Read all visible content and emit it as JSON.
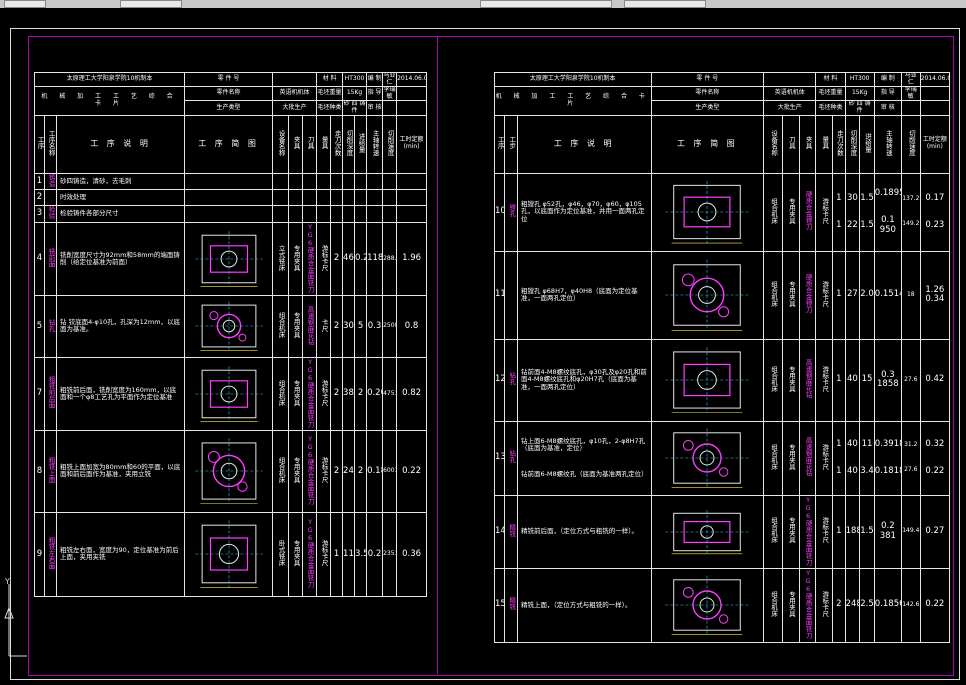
{
  "header": {
    "school": "太原理工大学阳泉学院10机制本",
    "part_no_label": "零 件 号",
    "material_label": "材  料",
    "material_value": "HT300",
    "author_label": "编  制",
    "author_value": "马亚仁",
    "date_value": "2014.06.01",
    "title": "机 械 加 工 工 艺 综 合 卡 片",
    "part_name_label": "零件名称",
    "part_name_value": "英语机机体",
    "blank_weight_label": "毛坯重量",
    "blank_weight_value": "15Kg",
    "designer_label": "指  导",
    "designer_value": "李瑞敏",
    "production_type_label": "生产类型",
    "production_type_value": "大批生产",
    "blank_type_label": "毛坯种类",
    "blank_type_value": "砂 四 铸 件",
    "reviewer_label": "审  核"
  },
  "columns": {
    "proc_no": "工序",
    "proc_name": "工序名称",
    "step": "工步",
    "desc": "工 序 说 明",
    "sketch": "工  序  简  图",
    "equipment": "设备名称",
    "fixture": "夹具",
    "tool": "刀具",
    "gauge": "量具",
    "passes": "走刀次数",
    "depth": "切削深度",
    "feed": "进给量",
    "speed": "主轴转速",
    "cut_speed": "切削速度",
    "time": "工时定额(min)"
  },
  "left_rows": [
    {
      "no": "1",
      "name": "铸造",
      "desc": "砂四铸造，清砂，去毛刺",
      "equip": "",
      "fix": "",
      "tool": "",
      "gauge": "",
      "passes": "",
      "depth": "",
      "feed": "",
      "speed": "",
      "vc": "",
      "time": ""
    },
    {
      "no": "2",
      "name": "",
      "desc": "时效处理",
      "equip": "",
      "fix": "",
      "tool": "",
      "gauge": "",
      "passes": "",
      "depth": "",
      "feed": "",
      "speed": "",
      "vc": "",
      "time": ""
    },
    {
      "no": "3",
      "name": "检验",
      "desc": "检验铸件各部分尺寸",
      "equip": "",
      "fix": "",
      "tool": "",
      "gauge": "",
      "passes": "",
      "depth": "",
      "feed": "",
      "speed": "",
      "vc": "",
      "time": ""
    },
    {
      "no": "4",
      "name": "铣前面",
      "desc": "铣削宽度尺寸为92mm和58mm的端面铸削（给定位基准为前面）",
      "equip": "立式铣床",
      "fix": "专用夹具",
      "tool": "YG6硬质合金面铣刀",
      "gauge": "游标卡尺",
      "passes": "2",
      "depth": "4624.0",
      "feed": "0.2",
      "speed": "1180",
      "vc": "288.4",
      "time": "1.96"
    },
    {
      "no": "5",
      "name": "钻孔",
      "desc": "钻 铰底面4-φ10孔，孔深为12mm，以底面为基准。",
      "equip": "组合机床",
      "fix": "专用夹具",
      "tool": "高速钢麻花钻",
      "gauge": "卡尺",
      "passes": "2",
      "depth": "30",
      "feed": "5",
      "speed": "0.3",
      "vc": "250078.5",
      "time": "0.8"
    },
    {
      "no": "7",
      "name": "粗铣前后面",
      "desc": "粗铣前后面，铣削宽度为160mm，以底面和一个φ8工艺孔为平面作为定位基准",
      "equip": "组合机床",
      "fix": "专用夹具",
      "tool": "YG6硬质合金面铣刀",
      "gauge": "游标卡尺",
      "passes": "2",
      "depth": "380",
      "feed": "2",
      "speed": "0.20",
      "vc": "475166.4",
      "time": "0.82"
    },
    {
      "no": "8",
      "name": "粗铣上面",
      "desc": "粗铣上面加宽为80mm和60的平面，以底面和前后面作为基准，夹用立铣",
      "equip": "组合机床",
      "fix": "专用夹具",
      "tool": "YG6硬质合金面铣刀",
      "gauge": "游标卡尺",
      "passes": "2",
      "depth": "244",
      "feed": "2",
      "speed": "0.18",
      "vc": "600150.72",
      "time": "0.22"
    },
    {
      "no": "9",
      "name": "粗铣左右面",
      "desc": "粗铣左右面，宽度为90，定位基准为前后上面，夹用夹铣",
      "equip": "卧式铣床",
      "fix": "专用夹具",
      "tool": "YG6硬质合金面铣刀",
      "gauge": "游标卡尺",
      "passes": "1",
      "depth": "115",
      "feed": "3.5",
      "speed": "0.2",
      "vc": "235116.1",
      "time": "0.36"
    }
  ],
  "left_extra": {
    "equip_code_4": "X52K",
    "equip_code_9": "X6025"
  },
  "right_rows": [
    {
      "no": "10",
      "name": "镗孔",
      "desc": "粗镗孔 φ52孔，φ46，φ70，φ60，φ105孔，以底面作为定位基准，并用一面两孔定位",
      "equip": "组合机床",
      "fix": "专用夹具",
      "tool": "硬质合金镗刀",
      "gauge": "游标卡尺",
      "p1": "1",
      "d1": "30",
      "f1": "1.5",
      "s1": "0.18950",
      "v1": "137.2",
      "t1": "0.17",
      "p2": "1",
      "d2": "22",
      "f2": "1.5",
      "s2": "0.1 950",
      "v2": "149.2",
      "t2": "0.23"
    },
    {
      "no": "11",
      "name": "",
      "desc": "粗镗孔 φ68H7，φ40H8（底面为定位基准，一面两孔定位）",
      "equip": "组合机床",
      "fix": "专用夹具",
      "tool": "硬质合金镗刀",
      "gauge": "游标卡尺",
      "p1": "1",
      "d1": "27",
      "f1": "2.0",
      "s1": "0.15144",
      "v1": "18",
      "t1": "1.26 0.34",
      "p2": "",
      "d2": "",
      "f2": "",
      "s2": "",
      "v2": "",
      "t2": ""
    },
    {
      "no": "12",
      "name": "钻孔",
      "desc": "钻前面4-M8螺纹底孔，φ30孔及φ20孔和前面4-M8螺纹底孔和φ20H7孔（底面为基准，一面两孔定位）",
      "equip": "组合机床",
      "fix": "专用夹具",
      "tool": "高速钢麻花钻",
      "gauge": "游标卡尺",
      "p1": "1",
      "d1": "40",
      "f1": "15",
      "s1": "0.3 1858",
      "v1": "27.6",
      "t1": "0.42",
      "p2": "",
      "d2": "",
      "f2": "",
      "s2": "",
      "v2": "",
      "t2": ""
    },
    {
      "no": "13",
      "name": "钻孔",
      "desc": "钻上面6-M8螺纹底孔，φ10孔，2-φ8H7孔（底面为基准，定位）",
      "desc2": "钻前面6-M8螺纹孔（底面为基准两孔定位）",
      "equip": "组合机床",
      "fix": "专用夹具",
      "tool": "高速钢麻花钻",
      "gauge": "游标卡尺",
      "p1": "1",
      "d1": "40",
      "f1": "11",
      "s1": "0.391858",
      "v1": "31.2",
      "t1": "0.32",
      "p2": "1",
      "d2": "40",
      "f2": "3.4",
      "s2": "0.181858",
      "v2": "27.6",
      "t2": "0.22"
    },
    {
      "no": "14",
      "name": "精铣",
      "desc": "精铣前后面，（定位方式与粗铣的一样）。",
      "equip": "组合机床",
      "fix": "专用夹具",
      "tool": "YG6硬质合金面铣刀",
      "gauge": "游标卡尺",
      "p1": "1",
      "d1": "188",
      "f1": "1.5",
      "s1": "0.2 381",
      "v1": "149.4",
      "t1": "0.27",
      "p2": "",
      "d2": "",
      "f2": "",
      "s2": "",
      "v2": "",
      "t2": ""
    },
    {
      "no": "15",
      "name": "精铣",
      "desc": "精铣上面，（定位方式与粗铣的一样）。",
      "equip": "组合机床",
      "fix": "专用夹具",
      "tool": "YG6硬质合金面铣刀",
      "gauge": "游标卡尺",
      "p1": "2",
      "d1": "248.5",
      "f1": "2.5",
      "s1": "0.18569",
      "v1": "142.6",
      "t1": "0.22",
      "p2": "",
      "d2": "",
      "f2": "",
      "s2": "",
      "v2": "",
      "t2": ""
    }
  ],
  "colors": {
    "frame": "#b000b0",
    "line": "#e6e6e6",
    "magenta": "#ff3cff",
    "cyan": "#3cc8ff",
    "bg": "#000000"
  }
}
